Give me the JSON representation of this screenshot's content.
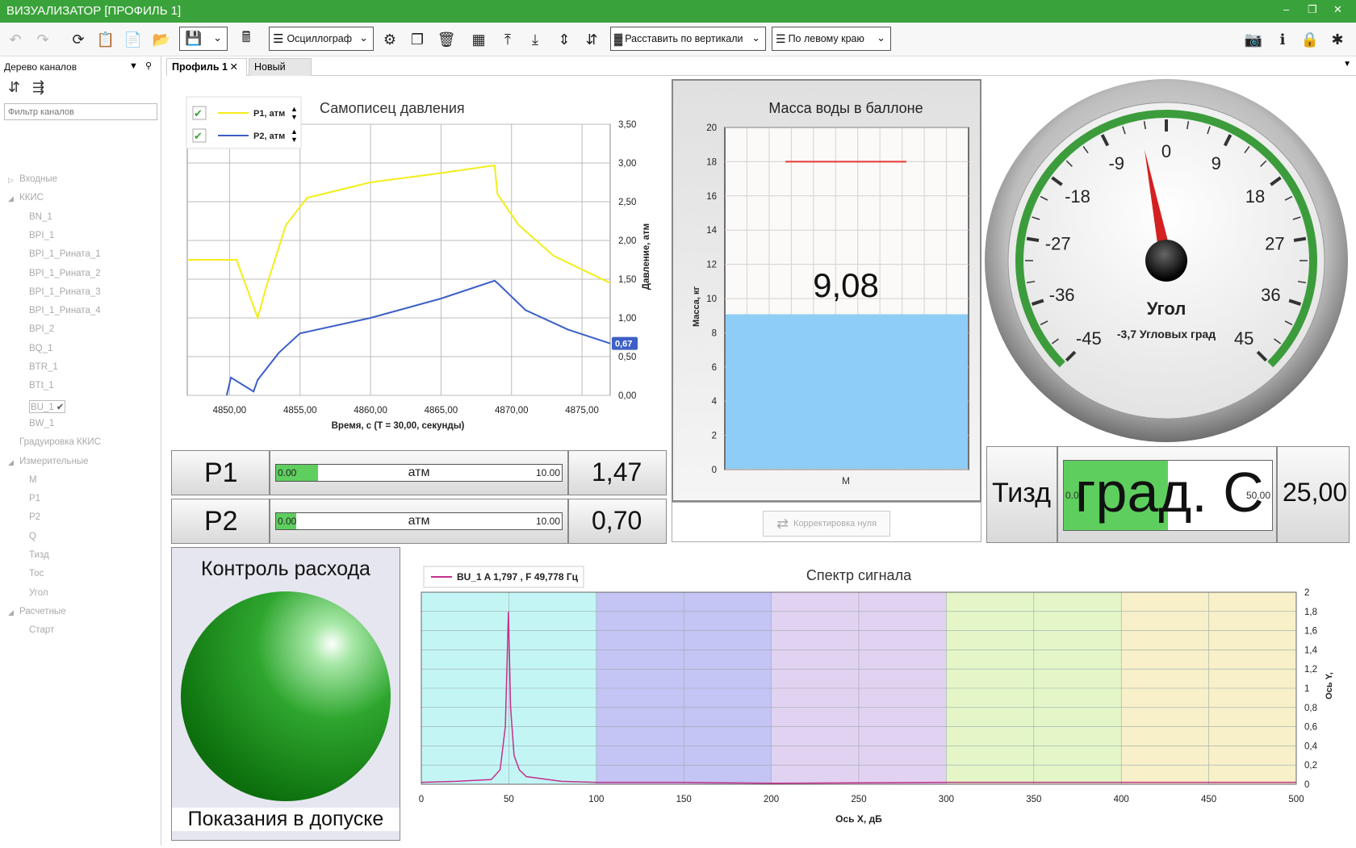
{
  "window": {
    "title": "ВИЗУАЛИЗАТОР [ПРОФИЛЬ 1]"
  },
  "toolbar": {
    "mode_label": "Осциллограф",
    "arrange_label": "Расставить по вертикали",
    "align_label": "По левому краю"
  },
  "sidebar": {
    "header": "Дерево каналов",
    "filter_placeholder": "Фильтр каналов",
    "tree": [
      {
        "label": "Входные"
      },
      {
        "label": "ККИС"
      },
      {
        "label": "BN_1"
      },
      {
        "label": "BPI_1"
      },
      {
        "label": "BPI_1_Рината_1"
      },
      {
        "label": "BPI_1_Рината_2"
      },
      {
        "label": "BPI_1_Рината_3"
      },
      {
        "label": "BPI_1_Рината_4"
      },
      {
        "label": "BPI_2"
      },
      {
        "label": "BQ_1"
      },
      {
        "label": "BTR_1"
      },
      {
        "label": "BTt_1"
      },
      {
        "label": "BU_1"
      },
      {
        "label": "BW_1"
      },
      {
        "label": "Градуировка ККИС"
      },
      {
        "label": "Измерительные"
      },
      {
        "label": "M"
      },
      {
        "label": "P1"
      },
      {
        "label": "P2"
      },
      {
        "label": "Q"
      },
      {
        "label": "Тизд"
      },
      {
        "label": "Тос"
      },
      {
        "label": "Угол"
      },
      {
        "label": "Расчетные"
      },
      {
        "label": "Старт"
      }
    ]
  },
  "tabs": [
    {
      "label": "Профиль 1"
    },
    {
      "label": "Новый"
    }
  ],
  "recorder": {
    "title": "Самописец давления",
    "legend": [
      "P1, атм",
      "P2, атм"
    ],
    "xlabel": "Время, с  (T = 30,00, секунды)",
    "ylabel": "Давление, атм",
    "x_ticks": [
      "4850,00",
      "4855,00",
      "4860,00",
      "4865,00",
      "4870,00",
      "4875,00"
    ],
    "y_ticks": [
      "0,00",
      "0,50",
      "1,00",
      "1,50",
      "2,00",
      "2,50",
      "3,00",
      "3,50"
    ],
    "last_value_badge": "0,67",
    "colors": {
      "p1": "#f2ee1a",
      "p2": "#3c5fc8"
    }
  },
  "chart_data": [
    {
      "type": "line",
      "title": "Самописец давления",
      "xlabel": "Время, с  (T = 30,00, секунды)",
      "ylabel": "Давление, атм",
      "xlim": [
        4847,
        4877
      ],
      "ylim": [
        0,
        3.5
      ],
      "grid": true,
      "legend": "top-left",
      "series": [
        {
          "name": "P1, атм",
          "x": [
            4847,
            4850.5,
            4852.0,
            4852.6,
            4854,
            4855.5,
            4860,
            4865,
            4868.8,
            4869,
            4870.5,
            4873,
            4877
          ],
          "y": [
            1.75,
            1.75,
            1.0,
            1.4,
            2.2,
            2.55,
            2.75,
            2.87,
            2.97,
            2.6,
            2.2,
            1.8,
            1.45
          ]
        },
        {
          "name": "P2, атм",
          "x": [
            4849.8,
            4850.1,
            4851.7,
            4852.0,
            4853.5,
            4855,
            4860,
            4865,
            4868.8,
            4869,
            4871,
            4874,
            4877
          ],
          "y": [
            0.0,
            0.23,
            0.05,
            0.2,
            0.55,
            0.8,
            1.0,
            1.25,
            1.48,
            1.45,
            1.1,
            0.85,
            0.67
          ]
        }
      ]
    },
    {
      "type": "bar",
      "title": "Масса воды в баллоне",
      "categories": [
        "M"
      ],
      "values": [
        9.08
      ],
      "ylabel": "Масса, кг",
      "ylim": [
        0,
        20
      ],
      "threshold": 18
    },
    {
      "type": "line",
      "title": "Спектр сигнала",
      "xlabel": "Ось X, дБ",
      "ylabel": "Ось Y,",
      "xlim": [
        0,
        500
      ],
      "ylim": [
        0,
        2
      ],
      "series": [
        {
          "name": "BU_1  A 1,797 , F 49,778 Гц",
          "x": [
            0,
            20,
            40,
            45,
            48,
            49.778,
            51,
            53,
            56,
            60,
            80,
            100,
            150,
            200,
            300,
            400,
            500
          ],
          "y": [
            0.02,
            0.03,
            0.05,
            0.15,
            0.6,
            1.797,
            0.8,
            0.3,
            0.15,
            0.08,
            0.03,
            0.02,
            0.02,
            0.01,
            0.02,
            0.02,
            0.02
          ]
        }
      ]
    }
  ],
  "bars": [
    {
      "name": "P1",
      "min": "0.00",
      "max": "10.00",
      "unit": "атм",
      "value": "1,47",
      "fraction": 0.147
    },
    {
      "name": "P2",
      "min": "0.00",
      "max": "10.00",
      "unit": "атм",
      "value": "0,70",
      "fraction": 0.07
    }
  ],
  "mass": {
    "title": "Масса воды в баллоне",
    "value": "9,08",
    "ylabel": "Масса, кг",
    "category": "M",
    "y_ticks": [
      "0",
      "2",
      "4",
      "6",
      "8",
      "10",
      "12",
      "14",
      "16",
      "18",
      "20"
    ],
    "zero_button": "Корректировка нуля"
  },
  "gauge": {
    "title": "Угол",
    "readout": "-3,7 Угловых град",
    "labels": [
      "-45",
      "-36",
      "-27",
      "-18",
      "-9",
      "0",
      "9",
      "18",
      "27",
      "36",
      "45"
    ],
    "value": -3.7,
    "min": -45,
    "max": 45
  },
  "tizd": {
    "name": "Тизд",
    "unit": "град. С",
    "min": "0.00",
    "max": "50.00",
    "value": "25,00",
    "fraction": 0.5
  },
  "flow": {
    "title": "Контроль расхода",
    "status": "Показания в допуске"
  },
  "spectrum": {
    "title": "Спектр сигнала",
    "legend": "BU_1  A 1,797 , F 49,778 Гц",
    "xlabel": "Ось X, дБ",
    "ylabel": "Ось Y,",
    "x_ticks": [
      "0",
      "50",
      "100",
      "150",
      "200",
      "250",
      "300",
      "350",
      "400",
      "450",
      "500"
    ],
    "y_ticks": [
      "0",
      "0,2",
      "0,4",
      "0,6",
      "0,8",
      "1",
      "1,2",
      "1,4",
      "1,6",
      "1,8",
      "2"
    ],
    "band_colors": [
      "#c4f5f5",
      "#c4c4f5",
      "#e2d2f2",
      "#e4f6c8",
      "#f7f0c8"
    ]
  }
}
